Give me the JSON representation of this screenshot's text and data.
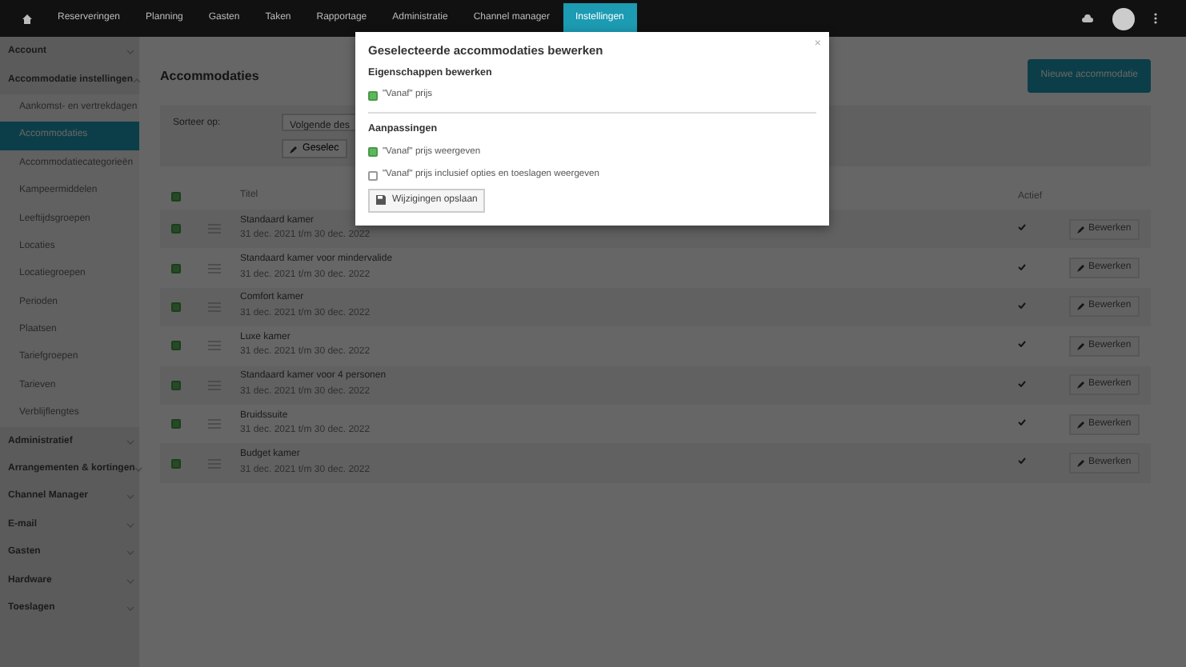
{
  "navbar": {
    "items": [
      {
        "label": "Reserveringen",
        "selected": false
      },
      {
        "label": "Planning",
        "selected": false
      },
      {
        "label": "Gasten",
        "selected": false
      },
      {
        "label": "Taken",
        "selected": false
      },
      {
        "label": "Rapportage",
        "selected": false
      },
      {
        "label": "Administratie",
        "selected": false
      },
      {
        "label": "Channel manager",
        "selected": false
      },
      {
        "label": "Instellingen",
        "selected": true
      }
    ]
  },
  "sidebar": {
    "sections": [
      {
        "label": "Account",
        "expanded": false
      },
      {
        "label": "Accommodatie instellingen",
        "expanded": true,
        "items": [
          {
            "label": "Aankomst- en vertrekdagen",
            "selected": false
          },
          {
            "label": "Accommodaties",
            "selected": true
          },
          {
            "label": "Accommodatiecategorieën",
            "selected": false
          },
          {
            "label": "Kampeermiddelen",
            "selected": false
          },
          {
            "label": "Leeftijdsgroepen",
            "selected": false
          },
          {
            "label": "Locaties",
            "selected": false
          },
          {
            "label": "Locatiegroepen",
            "selected": false
          },
          {
            "label": "Perioden",
            "selected": false
          },
          {
            "label": "Plaatsen",
            "selected": false
          },
          {
            "label": "Tariefgroepen",
            "selected": false
          },
          {
            "label": "Tarieven",
            "selected": false
          },
          {
            "label": "Verblijflengtes",
            "selected": false
          }
        ]
      },
      {
        "label": "Administratief",
        "expanded": false
      },
      {
        "label": "Arrangementen & kortingen",
        "expanded": false
      },
      {
        "label": "Channel Manager",
        "expanded": false
      },
      {
        "label": "E-mail",
        "expanded": false
      },
      {
        "label": "Gasten",
        "expanded": false
      },
      {
        "label": "Hardware",
        "expanded": false
      },
      {
        "label": "Toeslagen",
        "expanded": false
      }
    ]
  },
  "page": {
    "title": "Accommodaties",
    "new_button": "Nieuwe accommodatie"
  },
  "filter": {
    "sort_label": "Sorteer op:",
    "sort_value": "Volgende des",
    "edit_button": "Geselec"
  },
  "table": {
    "select_all_checked": true,
    "columns": [
      "Titel",
      "Actief"
    ],
    "rows": [
      {
        "checked": true,
        "title": "Standaard kamer",
        "period": "31 dec. 2021 t/m 30 dec. 2022",
        "active": true,
        "action": "Bewerken"
      },
      {
        "checked": true,
        "title": "Standaard kamer voor mindervalide",
        "period": "31 dec. 2021 t/m 30 dec. 2022",
        "active": true,
        "action": "Bewerken"
      },
      {
        "checked": true,
        "title": "Comfort kamer",
        "period": "31 dec. 2021 t/m 30 dec. 2022",
        "active": true,
        "action": "Bewerken"
      },
      {
        "checked": true,
        "title": "Luxe kamer",
        "period": "31 dec. 2021 t/m 30 dec. 2022",
        "active": true,
        "action": "Bewerken"
      },
      {
        "checked": true,
        "title": "Standaard kamer voor 4 personen",
        "period": "31 dec. 2021 t/m 30 dec. 2022",
        "active": true,
        "action": "Bewerken"
      },
      {
        "checked": true,
        "title": "Bruidssuite",
        "period": "31 dec. 2021 t/m 30 dec. 2022",
        "active": true,
        "action": "Bewerken"
      },
      {
        "checked": true,
        "title": "Budget kamer",
        "period": "31 dec. 2021 t/m 30 dec. 2022",
        "active": true,
        "action": "Bewerken"
      }
    ]
  },
  "modal": {
    "title": "Geselecteerde accommodaties bewerken",
    "close": "×",
    "sections": [
      {
        "heading": "Eigenschappen bewerken",
        "options": [
          {
            "label": "\"Vanaf\" prijs",
            "checked": true
          }
        ]
      },
      {
        "heading": "Aanpassingen",
        "options": [
          {
            "label": "\"Vanaf\" prijs weergeven",
            "checked": true
          },
          {
            "label": "\"Vanaf\" prijs inclusief opties en toeslagen weergeven",
            "checked": false
          }
        ]
      }
    ],
    "save_button": "Wijzigingen opslaan"
  }
}
